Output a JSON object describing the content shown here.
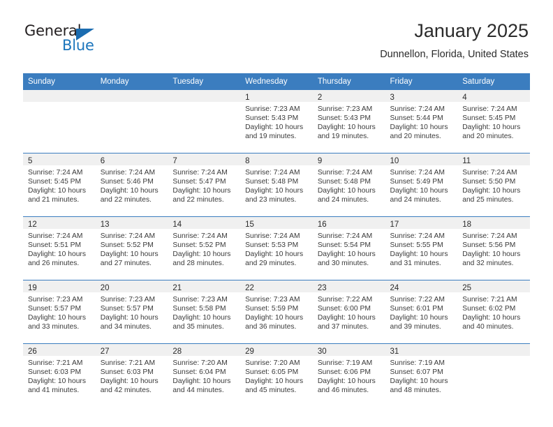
{
  "brand": {
    "word_one": "General",
    "word_two": "Blue",
    "triangle_icon": "triangle-logo-icon"
  },
  "header": {
    "title": "January 2025",
    "location": "Dunnellon, Florida, United States"
  },
  "colors": {
    "header_blue": "#3b7dbf",
    "brand_blue": "#1b75bc",
    "band_gray": "#f0f0f0",
    "text": "#2b2b2b"
  },
  "weekday_headers": [
    "Sunday",
    "Monday",
    "Tuesday",
    "Wednesday",
    "Thursday",
    "Friday",
    "Saturday"
  ],
  "labels": {
    "sunrise_prefix": "Sunrise:",
    "sunset_prefix": "Sunset:",
    "daylight_prefix": "Daylight:"
  },
  "weeks": [
    [
      {
        "day": "",
        "lines": []
      },
      {
        "day": "",
        "lines": []
      },
      {
        "day": "",
        "lines": []
      },
      {
        "day": "1",
        "lines": [
          "Sunrise: 7:23 AM",
          "Sunset: 5:43 PM",
          "Daylight: 10 hours and 19 minutes."
        ]
      },
      {
        "day": "2",
        "lines": [
          "Sunrise: 7:23 AM",
          "Sunset: 5:43 PM",
          "Daylight: 10 hours and 19 minutes."
        ]
      },
      {
        "day": "3",
        "lines": [
          "Sunrise: 7:24 AM",
          "Sunset: 5:44 PM",
          "Daylight: 10 hours and 20 minutes."
        ]
      },
      {
        "day": "4",
        "lines": [
          "Sunrise: 7:24 AM",
          "Sunset: 5:45 PM",
          "Daylight: 10 hours and 20 minutes."
        ]
      }
    ],
    [
      {
        "day": "5",
        "lines": [
          "Sunrise: 7:24 AM",
          "Sunset: 5:45 PM",
          "Daylight: 10 hours and 21 minutes."
        ]
      },
      {
        "day": "6",
        "lines": [
          "Sunrise: 7:24 AM",
          "Sunset: 5:46 PM",
          "Daylight: 10 hours and 22 minutes."
        ]
      },
      {
        "day": "7",
        "lines": [
          "Sunrise: 7:24 AM",
          "Sunset: 5:47 PM",
          "Daylight: 10 hours and 22 minutes."
        ]
      },
      {
        "day": "8",
        "lines": [
          "Sunrise: 7:24 AM",
          "Sunset: 5:48 PM",
          "Daylight: 10 hours and 23 minutes."
        ]
      },
      {
        "day": "9",
        "lines": [
          "Sunrise: 7:24 AM",
          "Sunset: 5:48 PM",
          "Daylight: 10 hours and 24 minutes."
        ]
      },
      {
        "day": "10",
        "lines": [
          "Sunrise: 7:24 AM",
          "Sunset: 5:49 PM",
          "Daylight: 10 hours and 24 minutes."
        ]
      },
      {
        "day": "11",
        "lines": [
          "Sunrise: 7:24 AM",
          "Sunset: 5:50 PM",
          "Daylight: 10 hours and 25 minutes."
        ]
      }
    ],
    [
      {
        "day": "12",
        "lines": [
          "Sunrise: 7:24 AM",
          "Sunset: 5:51 PM",
          "Daylight: 10 hours and 26 minutes."
        ]
      },
      {
        "day": "13",
        "lines": [
          "Sunrise: 7:24 AM",
          "Sunset: 5:52 PM",
          "Daylight: 10 hours and 27 minutes."
        ]
      },
      {
        "day": "14",
        "lines": [
          "Sunrise: 7:24 AM",
          "Sunset: 5:52 PM",
          "Daylight: 10 hours and 28 minutes."
        ]
      },
      {
        "day": "15",
        "lines": [
          "Sunrise: 7:24 AM",
          "Sunset: 5:53 PM",
          "Daylight: 10 hours and 29 minutes."
        ]
      },
      {
        "day": "16",
        "lines": [
          "Sunrise: 7:24 AM",
          "Sunset: 5:54 PM",
          "Daylight: 10 hours and 30 minutes."
        ]
      },
      {
        "day": "17",
        "lines": [
          "Sunrise: 7:24 AM",
          "Sunset: 5:55 PM",
          "Daylight: 10 hours and 31 minutes."
        ]
      },
      {
        "day": "18",
        "lines": [
          "Sunrise: 7:24 AM",
          "Sunset: 5:56 PM",
          "Daylight: 10 hours and 32 minutes."
        ]
      }
    ],
    [
      {
        "day": "19",
        "lines": [
          "Sunrise: 7:23 AM",
          "Sunset: 5:57 PM",
          "Daylight: 10 hours and 33 minutes."
        ]
      },
      {
        "day": "20",
        "lines": [
          "Sunrise: 7:23 AM",
          "Sunset: 5:57 PM",
          "Daylight: 10 hours and 34 minutes."
        ]
      },
      {
        "day": "21",
        "lines": [
          "Sunrise: 7:23 AM",
          "Sunset: 5:58 PM",
          "Daylight: 10 hours and 35 minutes."
        ]
      },
      {
        "day": "22",
        "lines": [
          "Sunrise: 7:23 AM",
          "Sunset: 5:59 PM",
          "Daylight: 10 hours and 36 minutes."
        ]
      },
      {
        "day": "23",
        "lines": [
          "Sunrise: 7:22 AM",
          "Sunset: 6:00 PM",
          "Daylight: 10 hours and 37 minutes."
        ]
      },
      {
        "day": "24",
        "lines": [
          "Sunrise: 7:22 AM",
          "Sunset: 6:01 PM",
          "Daylight: 10 hours and 39 minutes."
        ]
      },
      {
        "day": "25",
        "lines": [
          "Sunrise: 7:21 AM",
          "Sunset: 6:02 PM",
          "Daylight: 10 hours and 40 minutes."
        ]
      }
    ],
    [
      {
        "day": "26",
        "lines": [
          "Sunrise: 7:21 AM",
          "Sunset: 6:03 PM",
          "Daylight: 10 hours and 41 minutes."
        ]
      },
      {
        "day": "27",
        "lines": [
          "Sunrise: 7:21 AM",
          "Sunset: 6:03 PM",
          "Daylight: 10 hours and 42 minutes."
        ]
      },
      {
        "day": "28",
        "lines": [
          "Sunrise: 7:20 AM",
          "Sunset: 6:04 PM",
          "Daylight: 10 hours and 44 minutes."
        ]
      },
      {
        "day": "29",
        "lines": [
          "Sunrise: 7:20 AM",
          "Sunset: 6:05 PM",
          "Daylight: 10 hours and 45 minutes."
        ]
      },
      {
        "day": "30",
        "lines": [
          "Sunrise: 7:19 AM",
          "Sunset: 6:06 PM",
          "Daylight: 10 hours and 46 minutes."
        ]
      },
      {
        "day": "31",
        "lines": [
          "Sunrise: 7:19 AM",
          "Sunset: 6:07 PM",
          "Daylight: 10 hours and 48 minutes."
        ]
      },
      {
        "day": "",
        "lines": []
      }
    ]
  ]
}
